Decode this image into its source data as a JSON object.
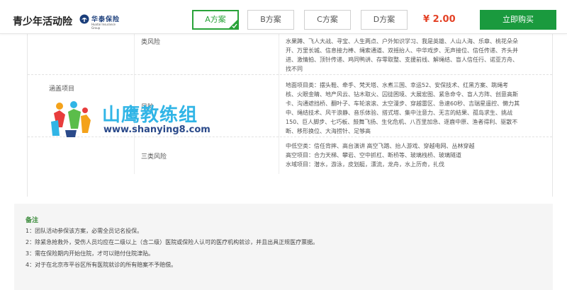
{
  "header": {
    "title": "青少年活动险",
    "logo": {
      "cn": "华泰保险",
      "en": "Huatai Insurance Group",
      "icon": "huatai-logo-icon"
    },
    "plans": [
      {
        "label": "A方案",
        "active": true
      },
      {
        "label": "B方案",
        "active": false
      },
      {
        "label": "C方案",
        "active": false
      },
      {
        "label": "D方案",
        "active": false
      }
    ],
    "price": "¥ 2.00",
    "buy_label": "立即购买",
    "accent": "#29a339",
    "buy_color": "#1a9a3e",
    "price_color": "#e44226"
  },
  "coverage": {
    "label": "涵盖项目",
    "rows": [
      {
        "name": "类风险",
        "lines": [
          "水果蹲、飞人大战、寻宝、人生两点、户外知识学习、我是英雄、人山人海、乐章、桃花朵朵",
          "开、万里长城、信息接力棒、绳索通道、双摇抬人、中华戏步、无声接位、信任传递、齐头并",
          "进、激情拍、顶针传递、鸡同鸭讲、存零取整、支援前线、解绳结、盲人信任行、诺亚方舟、",
          "找不同"
        ]
      },
      {
        "name": "风险",
        "lines": [
          "地面项目类：摆头鞋、牵手、梵天塔、水煮三国、幸运52、安保技术、红黑方案、跳绳考",
          "核、火眼金睛、地产风云、钻木取火、囚徒困境、大展宏图、紧急命令、盲人方阵、创意高斯",
          "卡、沟通遮挡桥、翻叶子、车轮滚滚、太空漫步、穿越雷区、急速60秒、吉瑞星遥控、懒力其",
          "中、绳结技术、风干浪静、音乐体验、搭式塔、集中注意力、无言的結果、孤岛求生、挑战",
          "150、巨人脚步、七巧板、鼓舞飞扬、生化危机、八百里加急、逐鹿中原、渔者得利、驱散不",
          "断、移形换位、大海捞针、足够高"
        ]
      },
      {
        "name": "三类风险",
        "lines": [
          "中低空类：信任背摔、高台演讲 高空飞踏、抬人游戏、穿越电网、丛林穿越",
          "高空项目：合力天梯、攀岩、空中抓杠、断桥等、玻璃栈桥、玻璃隧道",
          "水域项目：潜水，游泳，皮划艇，漂流，龙舟，水上历奇，扎伐"
        ]
      }
    ]
  },
  "watermark": {
    "cn": "山鹰教练组",
    "url": "www.shanying8.com",
    "icon": "people-figures-icon"
  },
  "notes": {
    "title": "备注",
    "items": [
      "1：团队活动参保该方案，必需全员记名投保。",
      "2：除紧急抢救外，受伤人员均应在二级以上（含二级）医院或保险人认可的医疗机构就诊，并且出具正规医疗票据。",
      "3：需在保险期内开始住院，才可以赔付住院津贴。",
      "4：对于在北京市平谷区所有医院就诊的所有赔案不予赔偿。"
    ]
  }
}
